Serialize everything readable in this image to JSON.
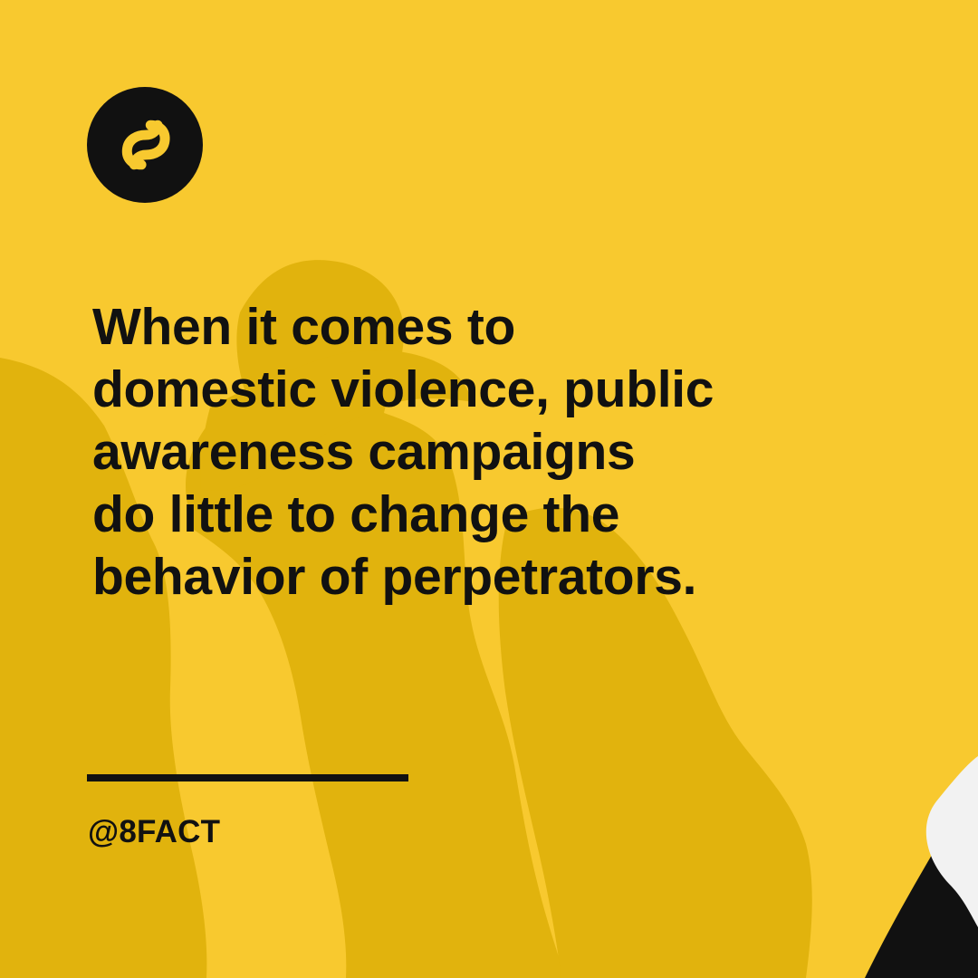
{
  "brand": {
    "logo_icon": "infinity-eight-icon",
    "handle": "@8FACT"
  },
  "headline": {
    "lines": [
      "When it comes to",
      "domestic violence, public",
      "awareness campaigns",
      "do little to change the",
      "behavior of perpetrators."
    ]
  },
  "colors": {
    "background": "#f8c92f",
    "shadow": "#e1b30d",
    "text": "#111111",
    "accent_black": "#111111",
    "corner_white": "#f2f2f2"
  }
}
